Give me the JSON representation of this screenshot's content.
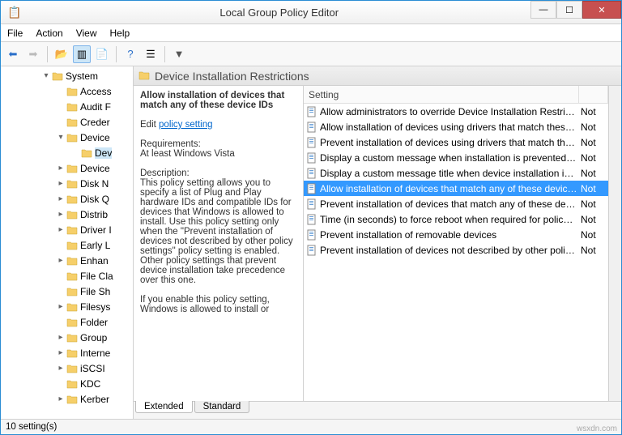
{
  "window": {
    "title": "Local Group Policy Editor"
  },
  "menu": {
    "file": "File",
    "action": "Action",
    "view": "View",
    "help": "Help"
  },
  "tree": {
    "root": "System",
    "items": [
      {
        "label": "Access",
        "exp": "",
        "indent": 1
      },
      {
        "label": "Audit F",
        "exp": "",
        "indent": 1
      },
      {
        "label": "Creder",
        "exp": "",
        "indent": 1
      },
      {
        "label": "Device",
        "exp": "▾",
        "indent": 1,
        "open": true
      },
      {
        "label": "Dev",
        "exp": "",
        "indent": 2,
        "sel": true
      },
      {
        "label": "Device",
        "exp": "▸",
        "indent": 1
      },
      {
        "label": "Disk N",
        "exp": "▸",
        "indent": 1
      },
      {
        "label": "Disk Q",
        "exp": "▸",
        "indent": 1
      },
      {
        "label": "Distrib",
        "exp": "▸",
        "indent": 1
      },
      {
        "label": "Driver I",
        "exp": "▸",
        "indent": 1
      },
      {
        "label": "Early L",
        "exp": "",
        "indent": 1
      },
      {
        "label": "Enhan",
        "exp": "▸",
        "indent": 1
      },
      {
        "label": "File Cla",
        "exp": "",
        "indent": 1
      },
      {
        "label": "File Sh",
        "exp": "",
        "indent": 1
      },
      {
        "label": "Filesys",
        "exp": "▸",
        "indent": 1
      },
      {
        "label": "Folder",
        "exp": "",
        "indent": 1
      },
      {
        "label": "Group",
        "exp": "▸",
        "indent": 1
      },
      {
        "label": "Interne",
        "exp": "▸",
        "indent": 1
      },
      {
        "label": "iSCSI",
        "exp": "▸",
        "indent": 1
      },
      {
        "label": "KDC",
        "exp": "",
        "indent": 1
      },
      {
        "label": "Kerber",
        "exp": "▸",
        "indent": 1
      }
    ]
  },
  "heading": "Device Installation Restrictions",
  "desc": {
    "title": "Allow installation of devices that match any of these device IDs",
    "edit_label": "Edit",
    "link": "policy setting",
    "req_label": "Requirements:",
    "req_value": "At least Windows Vista",
    "d_label": "Description:",
    "d_value": "This policy setting allows you to specify a list of Plug and Play hardware IDs and compatible IDs for devices that Windows is allowed to install. Use this policy setting only when the \"Prevent installation of devices not described by other policy settings\" policy setting is enabled. Other policy settings that prevent device installation take precedence over this one.",
    "d_value2": "If you enable this policy setting, Windows is allowed to install or"
  },
  "list": {
    "header_setting": "Setting",
    "rows": [
      {
        "t": "Allow administrators to override Device Installation Restricti...",
        "s": "Not"
      },
      {
        "t": "Allow installation of devices using drivers that match these ...",
        "s": "Not"
      },
      {
        "t": "Prevent installation of devices using drivers that match thes...",
        "s": "Not"
      },
      {
        "t": "Display a custom message when installation is prevented by...",
        "s": "Not"
      },
      {
        "t": "Display a custom message title when device installation is pr...",
        "s": "Not"
      },
      {
        "t": "Allow installation of devices that match any of these device ...",
        "s": "Not",
        "sel": true
      },
      {
        "t": "Prevent installation of devices that match any of these devic...",
        "s": "Not"
      },
      {
        "t": "Time (in seconds) to force reboot when required for policy c...",
        "s": "Not"
      },
      {
        "t": "Prevent installation of removable devices",
        "s": "Not"
      },
      {
        "t": "Prevent installation of devices not described by other policy ...",
        "s": "Not"
      }
    ]
  },
  "tabs": {
    "extended": "Extended",
    "standard": "Standard"
  },
  "status": "10 setting(s)",
  "watermark": "wsxdn.com"
}
